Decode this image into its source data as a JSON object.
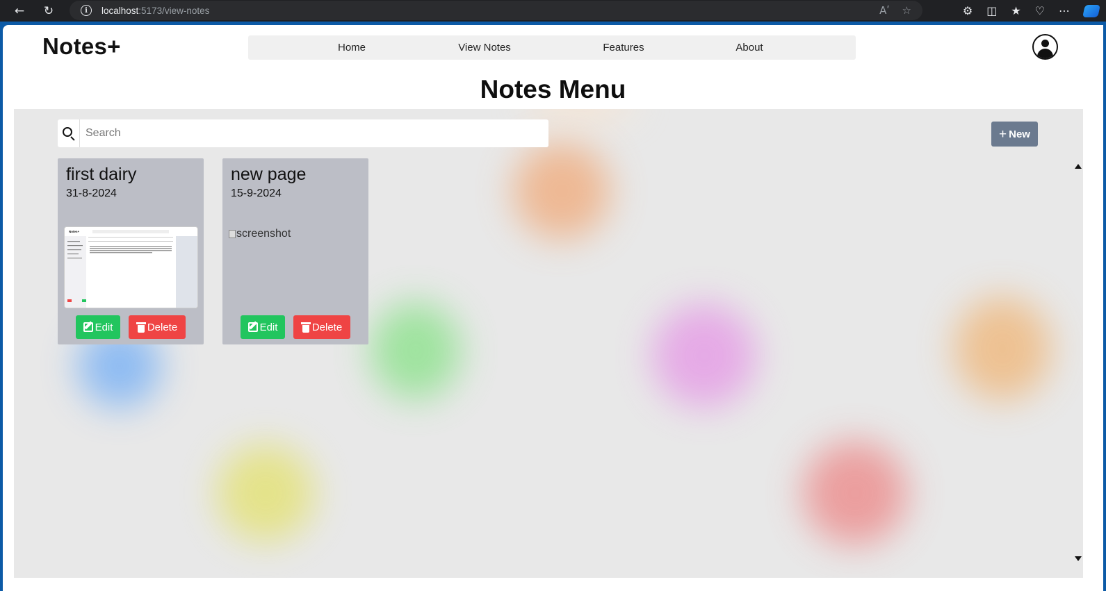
{
  "browser": {
    "url_host": "localhost",
    "url_path": ":5173/view-notes",
    "read_aloud": "Aʹ"
  },
  "app": {
    "logo": "Notes+",
    "nav": [
      "Home",
      "View Notes",
      "Features",
      "About"
    ]
  },
  "main": {
    "title": "Notes Menu",
    "search_placeholder": "Search",
    "new_button": "New"
  },
  "notes": [
    {
      "title": "first dairy",
      "date": "31-8-2024",
      "has_thumbnail": true,
      "thumbnail_logo": "Notes+"
    },
    {
      "title": "new page",
      "date": "15-9-2024",
      "has_thumbnail": false,
      "image_alt": "screenshot"
    }
  ],
  "card_actions": {
    "edit": "Edit",
    "delete": "Delete"
  },
  "colors": {
    "edit": "#22c55e",
    "delete": "#ef4444",
    "new_button": "#6b7a8f",
    "card": "#bcbec6",
    "board": "#e8e8e8"
  }
}
